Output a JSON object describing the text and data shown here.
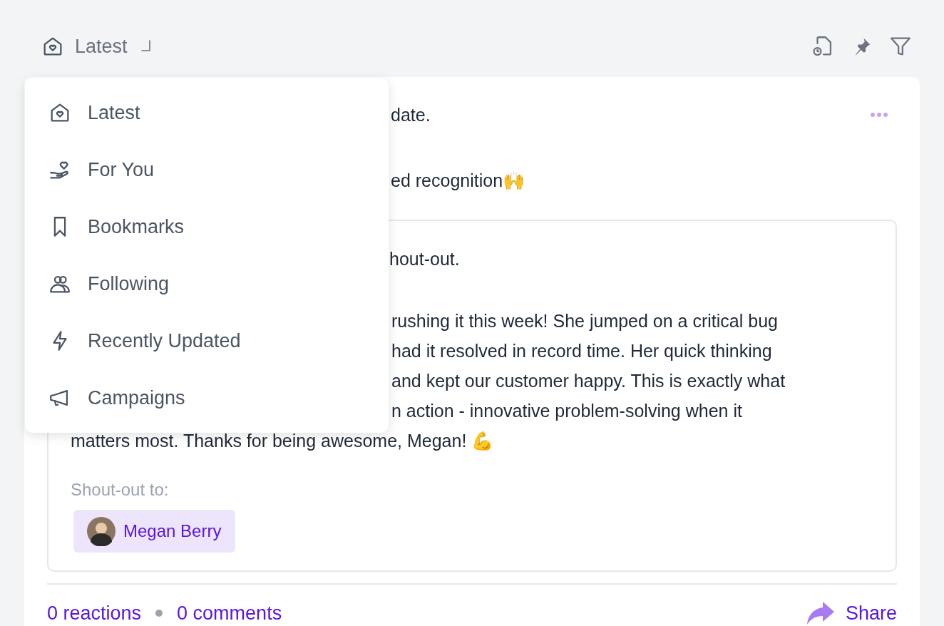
{
  "header": {
    "feed_label": "Latest"
  },
  "menu": {
    "items": [
      {
        "label": "Latest",
        "kind": "home"
      },
      {
        "label": "For You",
        "kind": "hand"
      },
      {
        "label": "Bookmarks",
        "kind": "bookmark"
      },
      {
        "label": "Following",
        "kind": "people"
      },
      {
        "label": "Recently Updated",
        "kind": "bolt"
      },
      {
        "label": "Campaigns",
        "kind": "megaphone"
      }
    ]
  },
  "post": {
    "lines": [
      "date.",
      "ed recognition🙌"
    ],
    "shoutout": {
      "lines": [
        "hout-out."
      ],
      "body_lines": [
        "rushing it this week! She jumped on a critical bug",
        "had it resolved in record time. Her quick thinking",
        "and kept our customer happy. This is exactly what",
        "n action - innovative problem-solving when it"
      ],
      "last_line": "matters most. Thanks for being awesome, Megan! 💪",
      "recipients_label": "Shout-out to:",
      "recipients": [
        {
          "name": "Megan Berry"
        }
      ]
    },
    "reactions": "0 reactions",
    "comments": "0 comments",
    "share": "Share"
  }
}
